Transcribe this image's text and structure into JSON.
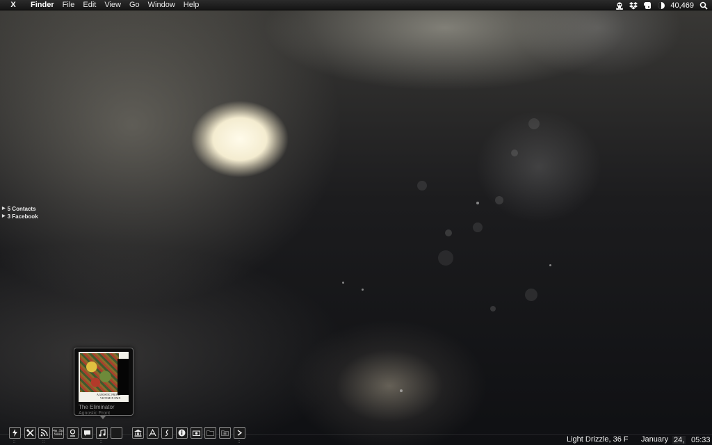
{
  "menubar": {
    "apple_glyph": "X",
    "app_name": "Finder",
    "menus": [
      "File",
      "Edit",
      "View",
      "Go",
      "Window",
      "Help"
    ],
    "status_icons": [
      "skull-crossbones-icon",
      "dropbox-icon",
      "evernote-icon",
      "moon-phase-icon"
    ],
    "count": "40,469",
    "search_icon": "magnifier-icon"
  },
  "side_widget": {
    "rows": [
      {
        "label": "5  Contacts"
      },
      {
        "label": "3  Facebook"
      }
    ]
  },
  "now_playing": {
    "title": "The Eliminator",
    "artist": "Agnostic Front",
    "cover_text_line1": "AGNOSTIC FRONT",
    "cover_text_line2": "VICTIM IN PAIN"
  },
  "dock": {
    "icons": [
      "lightning-icon",
      "tools-icon",
      "rss-icon",
      "stats-icon",
      "person-icon",
      "chat-icon",
      "music-note-icon",
      "blank-icon",
      "bank-icon",
      "font-icon",
      "script-icon",
      "info-icon",
      "camera-icon",
      "folder-icon",
      "photo-folder-icon",
      "arrow-icon"
    ],
    "stats_text_line1": "4m:5p",
    "stats_text_line2": "500a"
  },
  "weather": {
    "text": "Light Drizzle, 36 F"
  },
  "clock": {
    "month": "January",
    "day": "24,",
    "time": "05:33"
  }
}
